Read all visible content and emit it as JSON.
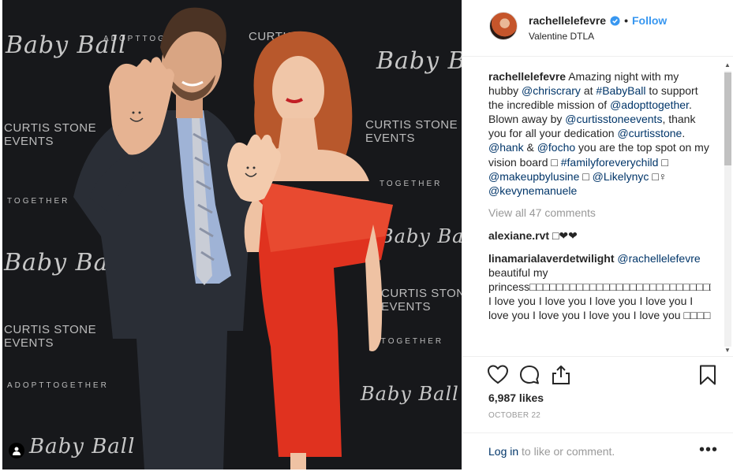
{
  "post": {
    "username": "rachellelefevre",
    "follow_label": "Follow",
    "dot": "•",
    "location": "Valentine DTLA"
  },
  "photo": {
    "backdrop": {
      "baby_ball": "Baby Ball",
      "curtis_stone_line1": "CURTIS STONE",
      "curtis_stone_line2": "EVENTS",
      "adopt_together": "ADOPTTOGETHER",
      "adopt_together_short": "TOGETHER",
      "curtis": "CURTIS",
      "ctogether": "ITOGETHER"
    }
  },
  "caption": {
    "user": "rachellelefevre",
    "t1": " Amazing night with my hubby ",
    "m1": "@chriscrary",
    "t2": " at ",
    "m2": "#BabyBall",
    "t3": " to support the incredible mission of ",
    "m3": "@adopttogether",
    "t4": ". Blown away by ",
    "m4": "@curtisstoneevents",
    "t5": ", thank you for all your dedication ",
    "m5": "@curtisstone",
    "t6": ". ",
    "m6": "@hank",
    "t7": " & ",
    "m7": "@focho",
    "t8": " you are the top spot on my vision board □ ",
    "m8": "#familyforeverychild",
    "t9": " □ ",
    "m9": "@makeupbylusine",
    "t10": " □ ",
    "m10": "@Likelynyc",
    "t11": " □♀ ",
    "m11": "@kevynemanuele"
  },
  "view_all": "View all 47 comments",
  "comments": [
    {
      "user": "alexiane.rvt",
      "text": " □❤❤"
    },
    {
      "user": "linamarialaverdetwilight",
      "mention": "@rachellelefevre",
      "text": " beautiful my princess□□□□□□□□□□□□□□□□□□□□□□□□□□□□□□□□□□□□□□□□□□□□□□□□□□□□□□□□□□□□□□□□□□□□□□□□□□□□□□□□□□□□□□□□□□□□□□□□□□□□□ I love you I love you I love you I love you I love you I love you I love you I love you □□□□"
    }
  ],
  "likes": "6,987 likes",
  "date": "OCTOBER 22",
  "login": {
    "link": "Log in",
    "text": " to like or comment.",
    "more": "•••"
  },
  "icons": {
    "like": "heart-icon",
    "comment": "comment-icon",
    "share": "share-icon",
    "save": "bookmark-icon",
    "verified": "verified-badge-icon",
    "tag": "user-tag-icon"
  },
  "colors": {
    "link": "#003569",
    "follow": "#3897f0",
    "muted": "#999999",
    "dress": "#e0321f"
  }
}
